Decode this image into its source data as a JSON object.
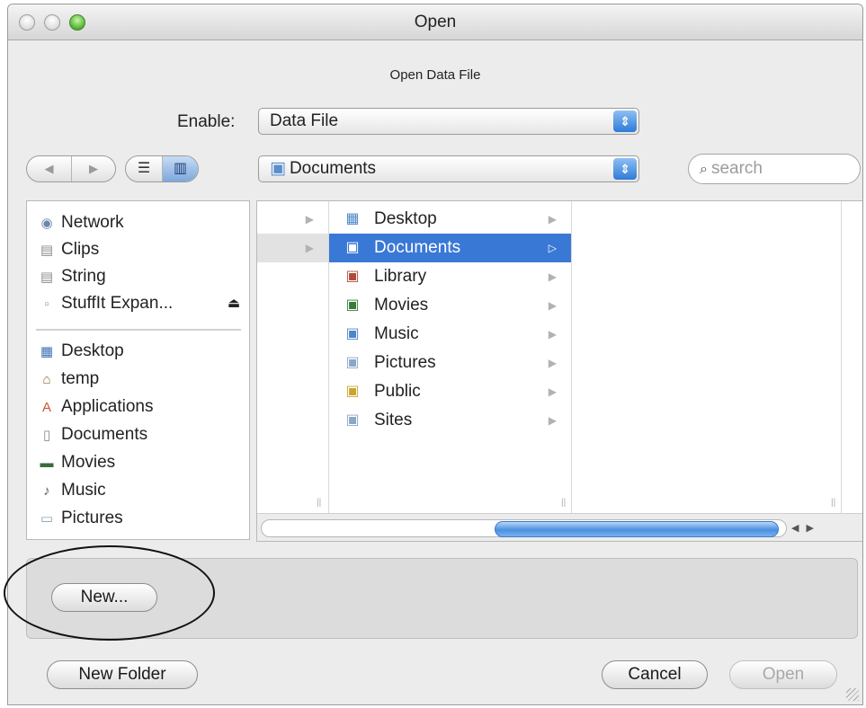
{
  "window": {
    "title": "Open",
    "subtitle": "Open Data File"
  },
  "enable": {
    "label": "Enable:",
    "value": "Data File"
  },
  "location": {
    "value": "Documents"
  },
  "search": {
    "placeholder": "search"
  },
  "sidebar": {
    "devices": [
      {
        "label": "Network",
        "icon": "network-icon"
      },
      {
        "label": "Clips",
        "icon": "disk-icon"
      },
      {
        "label": "String",
        "icon": "disk-icon"
      },
      {
        "label": "StuffIt Expan...",
        "icon": "volume-icon"
      }
    ],
    "places": [
      {
        "label": "Desktop",
        "icon": "desktop-icon"
      },
      {
        "label": "temp",
        "icon": "home-icon"
      },
      {
        "label": "Applications",
        "icon": "applications-icon"
      },
      {
        "label": "Documents",
        "icon": "documents-icon"
      },
      {
        "label": "Movies",
        "icon": "movies-icon"
      },
      {
        "label": "Music",
        "icon": "music-icon"
      },
      {
        "label": "Pictures",
        "icon": "pictures-icon"
      }
    ]
  },
  "browser": {
    "folders": [
      {
        "label": "Desktop",
        "icon": "desktop-folder-icon"
      },
      {
        "label": "Documents",
        "icon": "documents-folder-icon",
        "selected": true
      },
      {
        "label": "Library",
        "icon": "library-folder-icon"
      },
      {
        "label": "Movies",
        "icon": "movies-folder-icon"
      },
      {
        "label": "Music",
        "icon": "music-folder-icon"
      },
      {
        "label": "Pictures",
        "icon": "pictures-folder-icon"
      },
      {
        "label": "Public",
        "icon": "public-folder-icon"
      },
      {
        "label": "Sites",
        "icon": "sites-folder-icon"
      }
    ]
  },
  "accessory": {
    "new_label": "New..."
  },
  "footer": {
    "new_folder_label": "New Folder",
    "cancel_label": "Cancel",
    "open_label": "Open"
  },
  "colors": {
    "selection": "#3a78d6",
    "accent": "#2f7ad8"
  }
}
